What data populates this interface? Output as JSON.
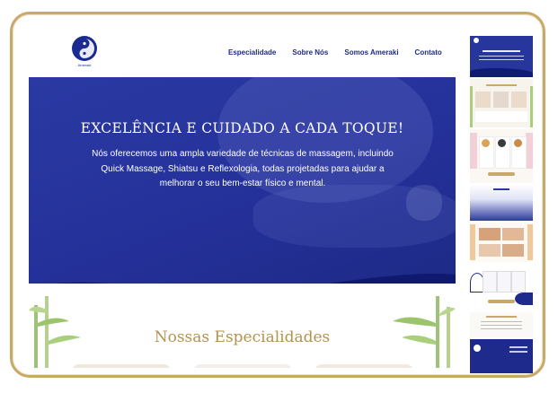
{
  "site": {
    "logo_text": "Ameraki",
    "nav": [
      {
        "label": "Especialidade"
      },
      {
        "label": "Sobre Nós"
      },
      {
        "label": "Somos Ameraki"
      },
      {
        "label": "Contato"
      }
    ],
    "hero": {
      "title": "EXCELÊNCIA E CUIDADO A CADA TOQUE!",
      "text": "Nós oferecemos uma ampla variedade de técnicas de massagem, incluindo Quick Massage, Shiatsu e Reflexologia, todas projetadas para ajudar a melhorar o seu bem-estar físico e mental."
    },
    "specialties_title": "Nossas Especialidades"
  },
  "colors": {
    "brand_blue": "#1e2a8c",
    "hero_blue": "#2a3aa3",
    "gold": "#b4924f",
    "frame": "#c9a96a"
  }
}
